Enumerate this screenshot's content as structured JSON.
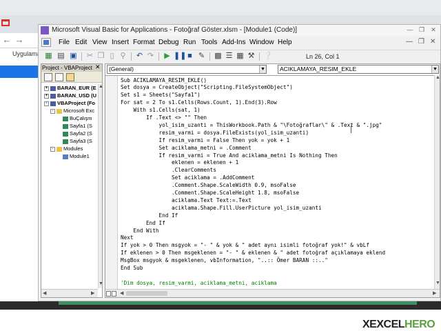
{
  "browser": {
    "bookmark": "Uygulama"
  },
  "window": {
    "title": "Microsoft Visual Basic for Applications - Fotoğraf Göster.xlsm - [Module1 (Code)]"
  },
  "menu": {
    "items": [
      "File",
      "Edit",
      "View",
      "Insert",
      "Format",
      "Debug",
      "Run",
      "Tools",
      "Add-Ins",
      "Window",
      "Help"
    ]
  },
  "toolbar": {
    "position": "Ln 26, Col 1"
  },
  "project": {
    "title": "Project - VBAProject",
    "tree": [
      {
        "label": "BARAN_EUR (E",
        "level": 0,
        "expander": "+",
        "icon": "vbproject",
        "bold": true
      },
      {
        "label": "BARAN_USD (U",
        "level": 0,
        "expander": "+",
        "icon": "vbproject",
        "bold": true
      },
      {
        "label": "VBAProject (Fo",
        "level": 0,
        "expander": "-",
        "icon": "vbproject",
        "bold": true
      },
      {
        "label": "Microsoft Exc",
        "level": 1,
        "expander": "-",
        "icon": "folder",
        "bold": false
      },
      {
        "label": "BuÇalışm",
        "level": 2,
        "expander": "",
        "icon": "sheet",
        "bold": false
      },
      {
        "label": "Sayfa1 (S",
        "level": 2,
        "expander": "",
        "icon": "sheet",
        "bold": false
      },
      {
        "label": "Sayfa2 (S",
        "level": 2,
        "expander": "",
        "icon": "sheet",
        "bold": false
      },
      {
        "label": "Sayfa3 (S",
        "level": 2,
        "expander": "",
        "icon": "sheet",
        "bold": false
      },
      {
        "label": "Modules",
        "level": 1,
        "expander": "-",
        "icon": "folder",
        "bold": false
      },
      {
        "label": "Module1",
        "level": 2,
        "expander": "",
        "icon": "module",
        "bold": false
      }
    ]
  },
  "code": {
    "object_combo": "(General)",
    "proc_combo": "ACIKLAMAYA_RESIM_EKLE",
    "lines": [
      {
        "text": "Sub ACIKLAMAYA_RESIM_EKLE()",
        "type": "code"
      },
      {
        "text": "Set dosya = CreateObject(\"Scripting.FileSystemObject\")",
        "type": "code"
      },
      {
        "text": "Set s1 = Sheets(\"Sayfa1\")",
        "type": "code"
      },
      {
        "text": "For sat = 2 To s1.Cells(Rows.Count, 1).End(3).Row",
        "type": "code"
      },
      {
        "text": "    With s1.Cells(sat, 1)",
        "type": "code"
      },
      {
        "text": "        If .Text <> \"\" Then",
        "type": "code"
      },
      {
        "text": "            yol_isim_uzanti = ThisWorkbook.Path & \"\\Fotoğraflar\\\" & .Text & \".jpg\"",
        "type": "code"
      },
      {
        "text": "            resim_varmi = dosya.FileExists(yol_isim_uzanti)",
        "type": "code"
      },
      {
        "text": "            If resim_varmi = False Then yok = yok + 1",
        "type": "code"
      },
      {
        "text": "            Set aciklama_metni = .Comment",
        "type": "code"
      },
      {
        "text": "            If resim_varmi = True And aciklama_metni Is Nothing Then",
        "type": "code"
      },
      {
        "text": "                eklenen = eklenen + 1",
        "type": "code"
      },
      {
        "text": "                .ClearComments",
        "type": "code"
      },
      {
        "text": "                Set aciklama = .AddComment",
        "type": "code"
      },
      {
        "text": "                .Comment.Shape.ScaleWidth 0.9, msoFalse",
        "type": "code"
      },
      {
        "text": "                .Comment.Shape.ScaleHeight 1.8, msoFalse",
        "type": "code"
      },
      {
        "text": "                aciklama.Text Text:=.Text",
        "type": "code"
      },
      {
        "text": "                aciklama.Shape.Fill.UserPicture yol_isim_uzanti",
        "type": "code"
      },
      {
        "text": "            End If",
        "type": "code"
      },
      {
        "text": "        End If",
        "type": "code"
      },
      {
        "text": "    End With",
        "type": "code"
      },
      {
        "text": "Next",
        "type": "code"
      },
      {
        "text": "If yok > 0 Then msgyok = \"- \" & yok & \" adet aynı isimli fotoğraf yok!\" & vbLf",
        "type": "code"
      },
      {
        "text": "If eklenen > 0 Then msgeklenen = \"- \" & eklenen & \" adet fotoğraf açıklamaya eklend",
        "type": "code"
      },
      {
        "text": "MsgBox msgyok & msgeklenen, vbInformation, \"..:: Ömer BARAN ::..\"",
        "type": "code"
      },
      {
        "text": "End Sub",
        "type": "code"
      },
      {
        "text": "",
        "type": "code"
      },
      {
        "text": "'Dim dosya, resim_varmi, aciklama_metni, aciklama",
        "type": "comment"
      }
    ]
  },
  "watermark": {
    "x": "X",
    "excel": "EXCEL",
    "hero": "HERO"
  }
}
